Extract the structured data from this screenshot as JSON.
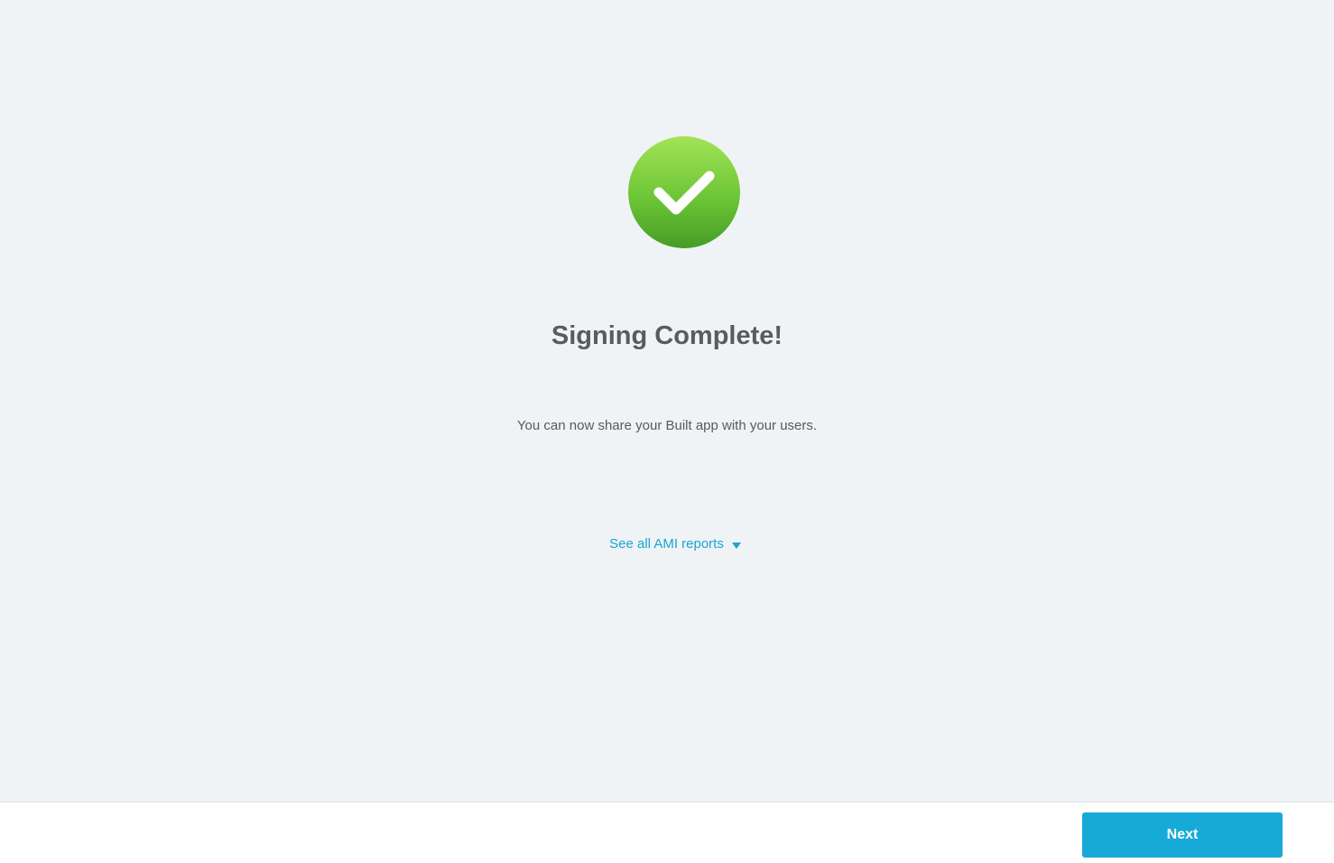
{
  "status": {
    "icon": "checkmark-circle-icon",
    "color": "#5dbb2f",
    "title": "Signing Complete!",
    "message": "You can now share your Built app with your users."
  },
  "reports": {
    "toggle_label": "See all AMI reports",
    "icon": "caret-down-icon",
    "color": "#19a5d2"
  },
  "footer": {
    "next_label": "Next",
    "accent": "#17a9d8"
  }
}
